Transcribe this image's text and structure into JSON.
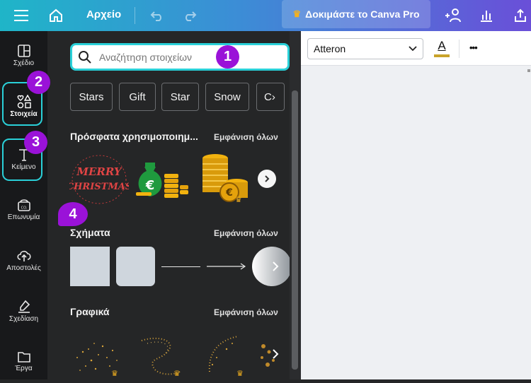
{
  "topbar": {
    "file_label": "Αρχείο",
    "pro_label": "Δοκιμάστε το Canva Pro",
    "icons": [
      "menu-icon",
      "home-icon",
      "undo-icon",
      "redo-icon",
      "crown-icon",
      "add-people-icon",
      "analytics-icon",
      "share-icon"
    ]
  },
  "leftnav": {
    "items": [
      {
        "label": "Σχέδιο",
        "icon": "layout-icon"
      },
      {
        "label": "Στοιχεία",
        "icon": "elements-icon"
      },
      {
        "label": "Κείμενο",
        "icon": "text-icon"
      },
      {
        "label": "Επωνυμία",
        "icon": "brand-icon"
      },
      {
        "label": "Αποστολές",
        "icon": "upload-icon"
      },
      {
        "label": "Σχεδίαση",
        "icon": "draw-icon"
      },
      {
        "label": "Έργα",
        "icon": "folder-icon"
      }
    ]
  },
  "search": {
    "placeholder": "Αναζήτηση στοιχείων"
  },
  "chips": [
    "Stars",
    "Gift",
    "Star",
    "Snow",
    "C"
  ],
  "sections": {
    "recent": {
      "title": "Πρόσφατα χρησιμοποιημ...",
      "link": "Εμφάνιση όλων"
    },
    "shapes": {
      "title": "Σχήματα",
      "link": "Εμφάνιση όλων"
    },
    "graphics": {
      "title": "Γραφικά",
      "link": "Εμφάνιση όλων"
    }
  },
  "recent_items": {
    "merry_line1": "MERRY",
    "merry_line2": "CHRISTMAS",
    "euro_symbol": "€"
  },
  "font_toolbar": {
    "font_value": "Atteron",
    "text_color_label": "A",
    "more_label": "•••"
  },
  "badges": [
    "1",
    "2",
    "3",
    "4"
  ],
  "colors": {
    "accent": "#2ad0d8",
    "badge": "#9a12d8",
    "crown": "#f3b11f"
  }
}
